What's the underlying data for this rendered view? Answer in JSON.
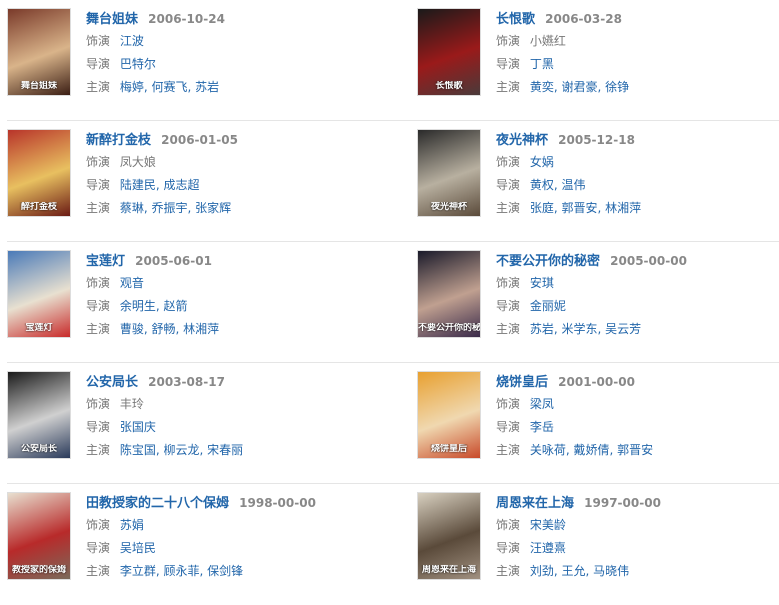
{
  "labels": {
    "role": "饰演",
    "director": "导演",
    "cast": "主演"
  },
  "items": [
    {
      "title": "舞台姐妹",
      "date": "2006-10-24",
      "role": "江波",
      "role_linked": true,
      "director": "巴特尔",
      "cast": "梅婷, 何赛飞, 苏岩",
      "poster_text": "舞台姐妹",
      "poster_colors": [
        "#7a3a2a",
        "#d9b48a",
        "#3b1e14"
      ]
    },
    {
      "title": "长恨歌",
      "date": "2006-03-28",
      "role": "小嬿红",
      "role_linked": false,
      "director": "丁黑",
      "cast": "黄奕, 谢君豪, 徐铮",
      "poster_text": "长恨歌",
      "poster_colors": [
        "#1a1a1a",
        "#9a1a1a",
        "#4a3a3a"
      ]
    },
    {
      "title": "新醉打金枝",
      "date": "2006-01-05",
      "role": "凤大娘",
      "role_linked": false,
      "director": "陆建民, 成志超",
      "cast": "蔡琳, 乔振宇, 张家辉",
      "poster_text": "醉打金枝",
      "poster_colors": [
        "#b8342a",
        "#e8c060",
        "#6a1a14"
      ]
    },
    {
      "title": "夜光神杯",
      "date": "2005-12-18",
      "role": "女娲",
      "role_linked": true,
      "director": "黄权, 温伟",
      "cast": "张庭, 郭晋安, 林湘萍",
      "poster_text": "夜光神杯",
      "poster_colors": [
        "#2a2a2a",
        "#b8b0a0",
        "#5a4a3a"
      ]
    },
    {
      "title": "宝莲灯",
      "date": "2005-06-01",
      "role": "观音",
      "role_linked": true,
      "director": "余明生, 赵箭",
      "cast": "曹骏, 舒畅, 林湘萍",
      "poster_text": "宝莲灯",
      "poster_colors": [
        "#4a7ab8",
        "#e8e0d0",
        "#c82a2a"
      ]
    },
    {
      "title": "不要公开你的秘密",
      "date": "2005-00-00",
      "role": "安琪",
      "role_linked": true,
      "director": "金丽妮",
      "cast": "苏岩, 米学东, 吴云芳",
      "poster_text": "不要公开你的秘密",
      "poster_colors": [
        "#1a1a2a",
        "#c0a090",
        "#3a2a4a"
      ]
    },
    {
      "title": "公安局长",
      "date": "2003-08-17",
      "role": "丰玲",
      "role_linked": false,
      "director": "张国庆",
      "cast": "陈宝国, 柳云龙, 宋春丽",
      "poster_text": "公安局长",
      "poster_colors": [
        "#1a1a1a",
        "#d0d0d0",
        "#2a3a5a"
      ]
    },
    {
      "title": "烧饼皇后",
      "date": "2001-00-00",
      "role": "梁凤",
      "role_linked": true,
      "director": "李岳",
      "cast": "关咏荷, 戴娇倩, 郭晋安",
      "poster_text": "烧饼皇后",
      "poster_colors": [
        "#e8a030",
        "#f0d8b0",
        "#c84a2a"
      ]
    },
    {
      "title": "田教授家的二十八个保姆",
      "date": "1998-00-00",
      "role": "苏娟",
      "role_linked": true,
      "director": "吴培民",
      "cast": "李立群, 顾永菲, 保剑锋",
      "poster_text": "教授家的保姆",
      "poster_colors": [
        "#e8e0d0",
        "#b82a2a",
        "#7a6a5a"
      ]
    },
    {
      "title": "周恩来在上海",
      "date": "1997-00-00",
      "role": "宋美龄",
      "role_linked": true,
      "director": "汪遵熹",
      "cast": "刘劲, 王允, 马晓伟",
      "poster_text": "周恩来在上海",
      "poster_colors": [
        "#d8d0c0",
        "#5a4a3a",
        "#a09080"
      ]
    }
  ]
}
